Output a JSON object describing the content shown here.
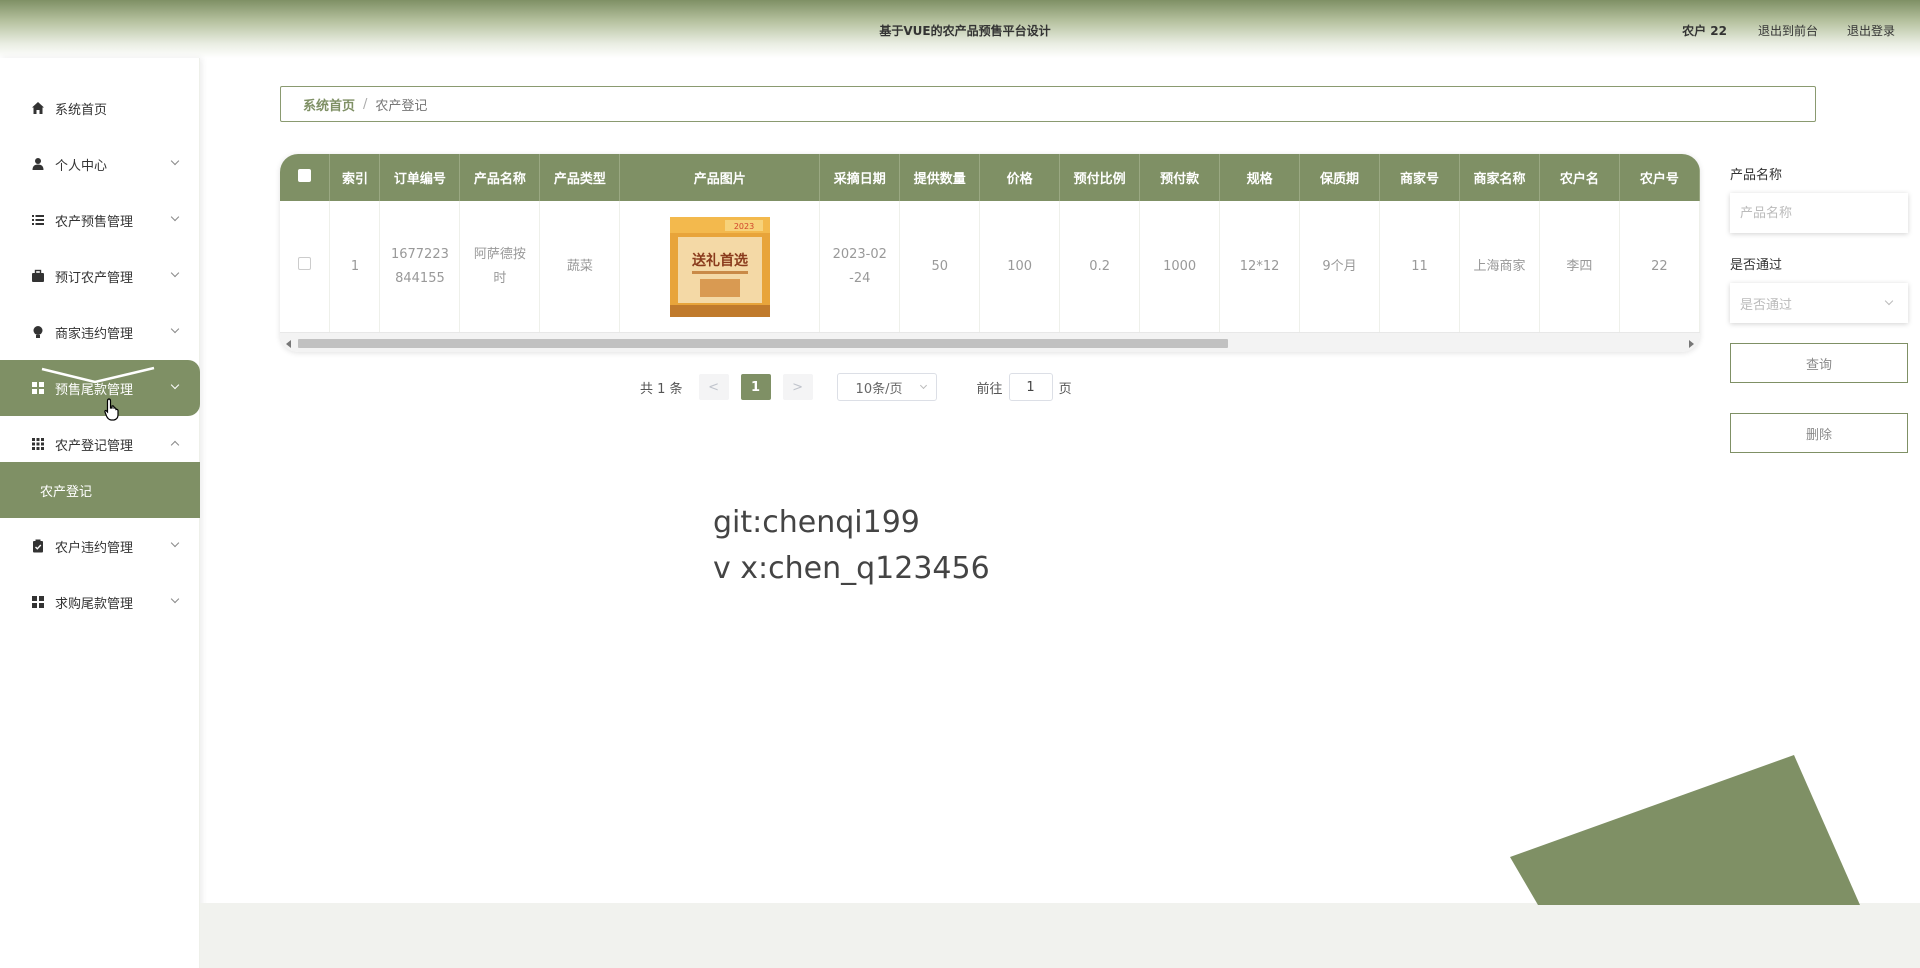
{
  "header": {
    "title": "基于VUE的农产品预售平台设计",
    "user": "农户 22",
    "front_link": "退出到前台",
    "logout_link": "退出登录"
  },
  "sidebar": {
    "items": [
      {
        "label": "系统首页",
        "icon": "home-icon"
      },
      {
        "label": "个人中心",
        "icon": "user-icon"
      },
      {
        "label": "农产预售管理",
        "icon": "list-icon"
      },
      {
        "label": "预订农产管理",
        "icon": "briefcase-icon"
      },
      {
        "label": "商家违约管理",
        "icon": "bulb-icon"
      },
      {
        "label": "预售尾款管理",
        "icon": "grid-icon"
      },
      {
        "label": "农产登记管理",
        "icon": "apps-icon"
      },
      {
        "label": "农户违约管理",
        "icon": "clipboard-icon"
      },
      {
        "label": "求购尾款管理",
        "icon": "grid-icon"
      }
    ],
    "active_index": 5,
    "expanded_index": 6,
    "submenu": {
      "label": "农产登记"
    }
  },
  "breadcrumb": {
    "home": "系统首页",
    "separator": "/",
    "current": "农产登记"
  },
  "table": {
    "columns": [
      "索引",
      "订单编号",
      "产品名称",
      "产品类型",
      "产品图片",
      "采摘日期",
      "提供数量",
      "价格",
      "预付比例",
      "预付款",
      "规格",
      "保质期",
      "商家号",
      "商家名称",
      "农户名",
      "农户号"
    ],
    "rows": [
      {
        "index": "1",
        "order_no_l1": "1677223",
        "order_no_l2": "844155",
        "product_name_l1": "阿萨德按",
        "product_name_l2": "时",
        "product_type": "蔬菜",
        "image": {
          "main_text": "送礼首选",
          "top_text": "2023"
        },
        "pick_date_l1": "2023-02",
        "pick_date_l2": "-24",
        "quantity": "50",
        "price": "100",
        "prepay_ratio": "0.2",
        "prepay": "1000",
        "spec": "12*12",
        "shelf_life": "9个月",
        "merchant_no": "11",
        "merchant_name": "上海商家",
        "farmer_name": "李四",
        "farmer_no": "22"
      }
    ]
  },
  "pagination": {
    "total": "共 1 条",
    "prev": "<",
    "current_page": "1",
    "next": ">",
    "page_size": "10条/页",
    "goto_prefix": "前往",
    "goto_value": "1",
    "goto_suffix": "页"
  },
  "filters": {
    "name_label": "产品名称",
    "name_placeholder": "产品名称",
    "pass_label": "是否通过",
    "pass_placeholder": "是否通过",
    "search_button": "查询",
    "delete_button": "删除"
  },
  "watermark": {
    "line1": "git:chenqi199",
    "line2": "v x:chen_q123456"
  },
  "colors": {
    "accent": "#7f9065",
    "accent_light": "#b4c09d"
  }
}
